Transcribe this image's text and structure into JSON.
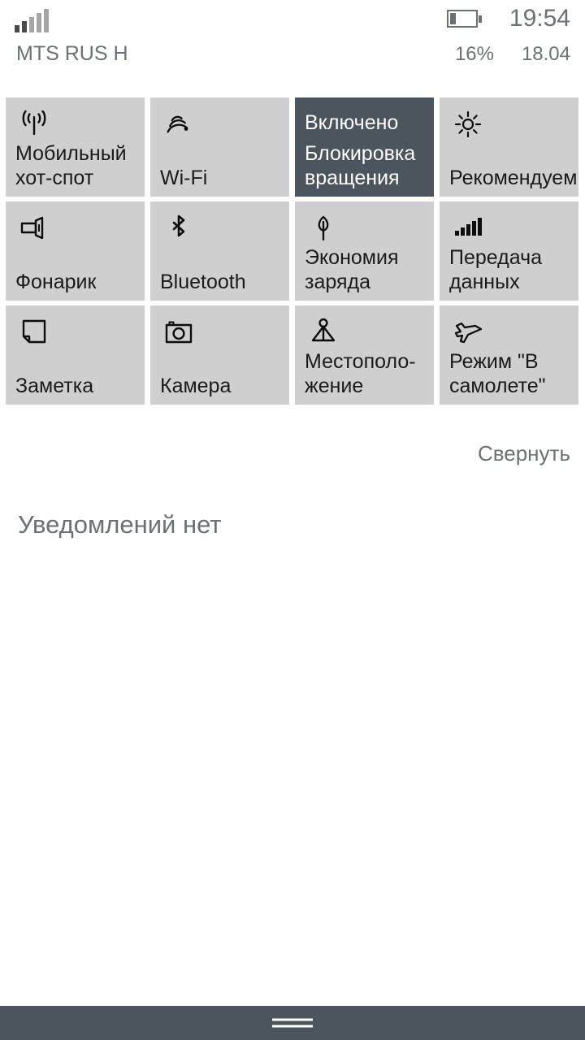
{
  "status_bar": {
    "signal_icon": "cellular-signal-icon",
    "signal_bars_total": 5,
    "signal_bars_active": 2,
    "battery_icon": "battery-icon",
    "battery_level_percent": 16,
    "time": "19:54",
    "carrier": "MTS RUS  H",
    "battery_text": "16%",
    "date": "18.04"
  },
  "quick_actions": {
    "rows": [
      [
        {
          "icon": "mobile-hotspot-icon",
          "label": "Мобильный\nхот-спот",
          "state": "",
          "active": false
        },
        {
          "icon": "wifi-icon",
          "label": "Wi-Fi",
          "state": "",
          "active": false
        },
        {
          "icon": "rotation-lock-icon",
          "label": "Блокировка\nвращения",
          "state": "Включено",
          "active": true
        },
        {
          "icon": "brightness-icon",
          "label": "Рекомендуемы",
          "state": "",
          "active": false
        }
      ],
      [
        {
          "icon": "flashlight-icon",
          "label": "Фонарик",
          "state": "",
          "active": false
        },
        {
          "icon": "bluetooth-icon",
          "label": "Bluetooth",
          "state": "",
          "active": false
        },
        {
          "icon": "battery-saver-leaf-icon",
          "label": "Экономия\nзаряда",
          "state": "",
          "active": false
        },
        {
          "icon": "cellular-data-icon",
          "label": "Передача\nданных",
          "state": "",
          "active": false
        }
      ],
      [
        {
          "icon": "note-icon",
          "label": "Заметка",
          "state": "",
          "active": false
        },
        {
          "icon": "camera-icon",
          "label": "Камера",
          "state": "",
          "active": false
        },
        {
          "icon": "location-icon",
          "label": "Местополо-\nжение",
          "state": "",
          "active": false
        },
        {
          "icon": "airplane-mode-icon",
          "label": "Режим \"В\nсамолете\"",
          "state": "",
          "active": false
        }
      ]
    ],
    "collapse_label": "Свернуть"
  },
  "notifications": {
    "empty_text": "Уведомлений нет"
  },
  "nav_bar": {
    "handle_icon": "drag-handle-icon"
  },
  "colors": {
    "tile_inactive": "#cfcfcf",
    "tile_active": "#4c555d",
    "nav_bar": "#4c555d",
    "muted_text": "#6b7073",
    "primary_text": "#1a1a1a",
    "page_background": "#ffffff"
  }
}
